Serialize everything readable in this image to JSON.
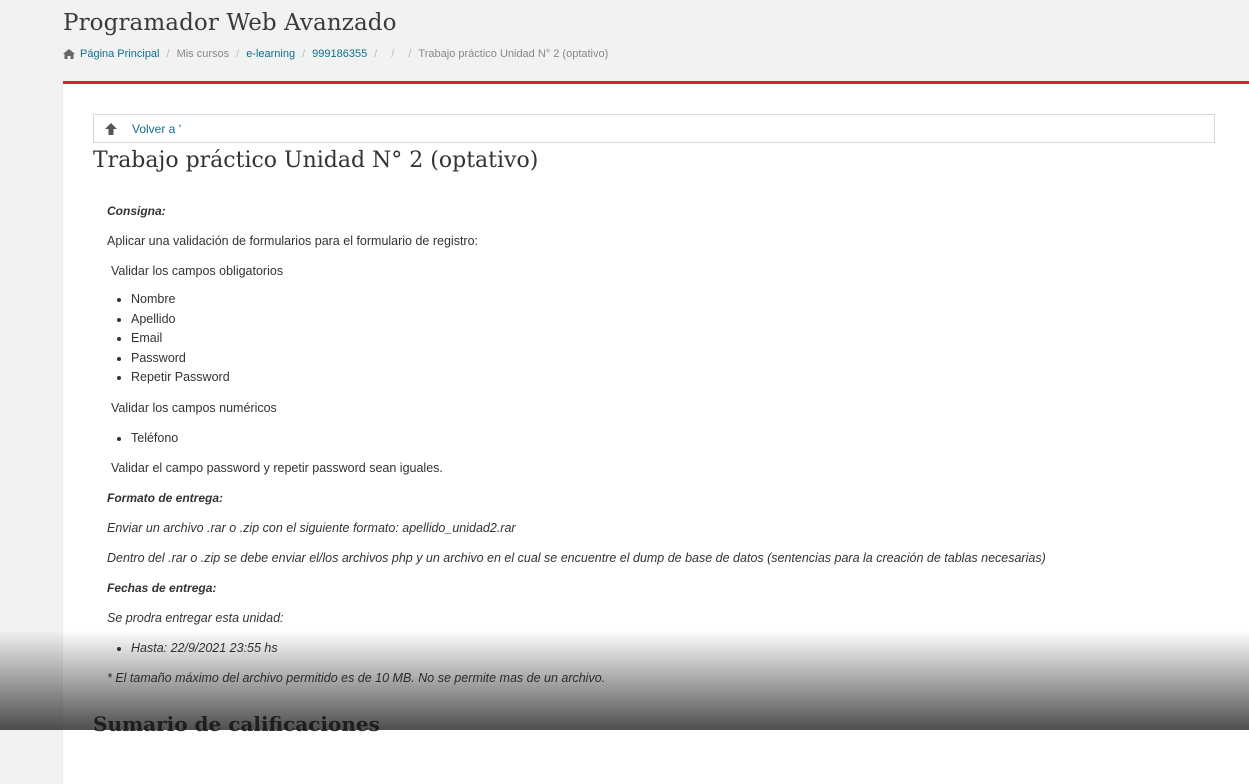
{
  "header": {
    "course_title": "Programador Web Avanzado",
    "breadcrumb": {
      "home": "Página Principal",
      "my_courses": "Mis cursos",
      "category": "e-learning",
      "course_code": "999186355",
      "current": "Trabajo práctico Unidad N° 2 (optativo)"
    }
  },
  "back": {
    "label": "Volver a '"
  },
  "activity": {
    "title": "Trabajo práctico Unidad N° 2 (optativo)"
  },
  "assignment": {
    "consigna_label": "Consigna:",
    "intro": "Aplicar una validación de formularios para el formulario de registro:",
    "required_label": "Validar los campos obligatorios",
    "required_fields": [
      "Nombre",
      "Apellido",
      "Email",
      "Password",
      "Repetir Password"
    ],
    "numeric_label": "Validar los campos numéricos",
    "numeric_fields": [
      "Teléfono"
    ],
    "password_rule": "Validar el campo password y repetir password sean iguales.",
    "formato_label": "Formato de entrega:",
    "formato_line1": "Enviar un archivo .rar o .zip con el siguiente formato: apellido_unidad2.rar",
    "formato_line2": "Dentro del .rar o .zip se debe enviar el/los archivos php y un archivo en el cual se encuentre el dump de base de datos (sentencias para la creación de tablas necesarias)",
    "fechas_label": "Fechas de entrega:",
    "fechas_intro": "Se prodra entregar esta unidad:",
    "deadline": "Hasta: 22/9/2021 23:55 hs",
    "file_note": "* El tamaño máximo del archivo permitido es de 10 MB. No se permite mas de un archivo."
  },
  "summary": {
    "title": "Sumario de calificaciones"
  },
  "colors": {
    "accent_red": "#d3232c",
    "link_blue": "#0f6f8f"
  }
}
